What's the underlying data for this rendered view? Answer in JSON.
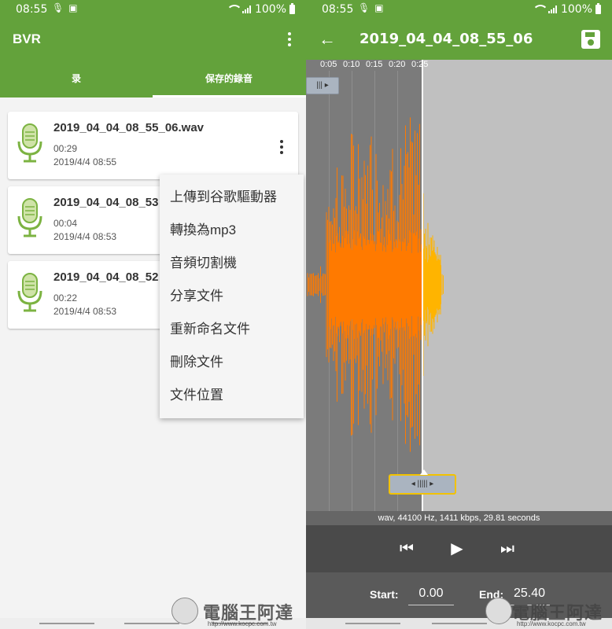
{
  "status": {
    "time": "08:55",
    "battery": "100%"
  },
  "left": {
    "app_title": "BVR",
    "tabs": [
      {
        "label": "录"
      },
      {
        "label": "保存的錄音"
      }
    ],
    "recordings": [
      {
        "name": "2019_04_04_08_55_06.wav",
        "duration": "00:29",
        "date": "2019/4/4 08:55"
      },
      {
        "name": "2019_04_04_08_53",
        "duration": "00:04",
        "date": "2019/4/4 08:53"
      },
      {
        "name": "2019_04_04_08_52",
        "duration": "00:22",
        "date": "2019/4/4 08:53"
      }
    ],
    "menu": [
      {
        "label": "上傳到谷歌驅動器"
      },
      {
        "label": "轉換為mp3"
      },
      {
        "label": "音頻切割機"
      },
      {
        "label": "分享文件"
      },
      {
        "label": "重新命名文件"
      },
      {
        "label": "刪除文件"
      },
      {
        "label": "文件位置"
      }
    ]
  },
  "right": {
    "title": "2019_04_04_08_55_06",
    "timeline": [
      "0:05",
      "0:10",
      "0:15",
      "0:20",
      "0:25"
    ],
    "info": "wav, 44100 Hz, 1411 kbps, 29.81 seconds",
    "start_label": "Start:",
    "start_value": "0.00",
    "end_label": "End:",
    "end_value": "25.40"
  },
  "watermark": {
    "text": "電腦王阿達",
    "url": "http://www.kocpc.com.tw"
  },
  "colors": {
    "brand": "#63a23b",
    "wave_played": "#ff7a00",
    "wave_unplayed": "#ffb400"
  }
}
